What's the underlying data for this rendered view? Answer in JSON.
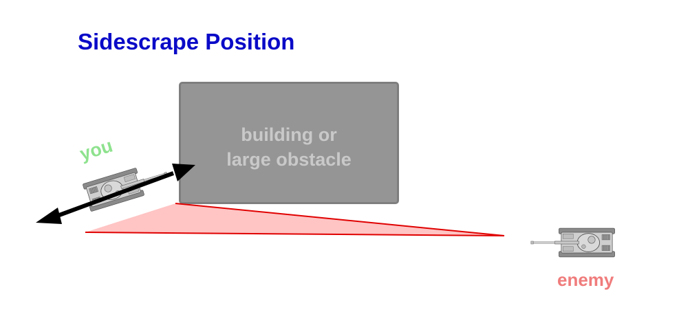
{
  "title": "Sidescrape Position",
  "obstacle": {
    "label": "building or\nlarge obstacle"
  },
  "tanks": {
    "you_label": "you",
    "enemy_label": "enemy"
  },
  "colors": {
    "title": "#0a0ac8",
    "obstacle_fill": "#959595",
    "obstacle_text": "#c9c9c9",
    "you_label": "#8ee28e",
    "enemy_label": "#f07c7c",
    "sightline": "#e00000",
    "sightline_fill": "#ffc4c4"
  },
  "icons": [
    "tank-icon",
    "double-arrow-icon"
  ]
}
